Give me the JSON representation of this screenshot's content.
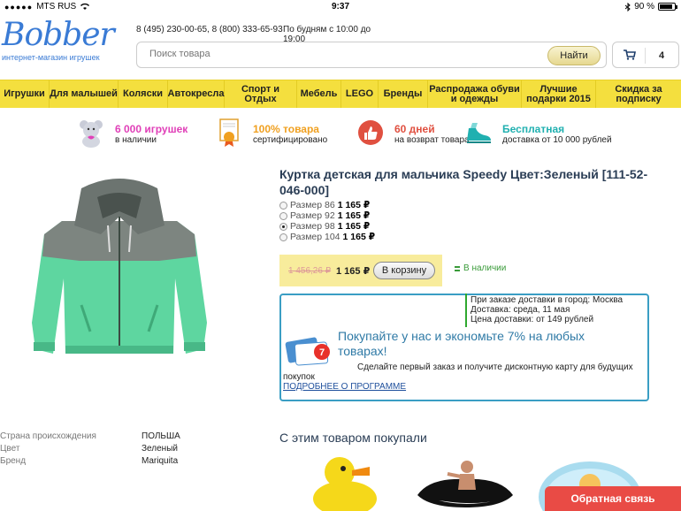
{
  "status_bar": {
    "carrier": "MTS RUS",
    "time": "9:37",
    "battery": "90 %",
    "battery_level": 0.9
  },
  "header": {
    "logo_text": "Bobber",
    "logo_tagline": "интернет-магазин игрушек",
    "phones": "8 (495) 230-00-65, 8 (800) 333-65-93",
    "hours": "По будням с 10:00 до 19:00",
    "search_placeholder": "Поиск товара",
    "search_button": "Найти",
    "cart_count": "4"
  },
  "nav": {
    "items": [
      "Игрушки",
      "Для малышей",
      "Коляски",
      "Автокресла",
      "Спорт и Отдых",
      "Мебель",
      "LEGO",
      "Бренды",
      "Распродажа обуви и одежды",
      "Лучшие подарки 2015",
      "Скидка за подписку"
    ]
  },
  "features": [
    {
      "title": "6 000 игрушек",
      "subtitle": "в наличии",
      "icon": "teddy-bear-icon",
      "color": "#e040b8"
    },
    {
      "title": "100% товара",
      "subtitle": "сертифицировано",
      "icon": "certificate-icon",
      "color": "#f0a020"
    },
    {
      "title": "60 дней",
      "subtitle": "на возврат товара",
      "icon": "thumbs-up-icon",
      "color": "#e05040"
    },
    {
      "title": "Бесплатная",
      "subtitle": "доставка от 10 000 рублей",
      "icon": "shoe-icon",
      "color": "#20b0b0"
    }
  ],
  "product": {
    "title": "Куртка детская для мальчика Speedy Цвет:Зеленый [111-52-046-000]",
    "sizes": [
      {
        "label": "Размер 86",
        "price": "1 165 ₽",
        "selected": false
      },
      {
        "label": "Размер 92",
        "price": "1 165 ₽",
        "selected": false
      },
      {
        "label": "Размер 98",
        "price": "1 165 ₽",
        "selected": true
      },
      {
        "label": "Размер 104",
        "price": "1 165 ₽",
        "selected": false
      }
    ],
    "old_price": "1 456,26 ₽",
    "price": "1 165 ₽",
    "cart_button": "В корзину",
    "stock": "В наличии"
  },
  "delivery": {
    "line1": "При заказе доставки в город: Москва",
    "line2": "Доставка: среда, 11 мая",
    "line3": "Цена доставки: от 149 рублей",
    "promo_heading": "Покупайте у нас и экономьте 7% на любых товарах!",
    "promo_text": "Сделайте первый заказ и получите дисконтную карту для будущих покупок",
    "promo_link": "ПОДРОБНЕЕ О ПРОГРАММЕ",
    "card_badge": "7"
  },
  "specs": [
    {
      "key": "Страна происхождения",
      "value": "ПОЛЬША"
    },
    {
      "key": "Цвет",
      "value": "Зеленый"
    },
    {
      "key": "Бренд",
      "value": "Mariquita"
    }
  ],
  "also_bought": {
    "heading": "С этим товаром покупали"
  },
  "feedback_button": "Обратная связь",
  "colors": {
    "nav_bg": "#f4df3e",
    "jacket_green": "#5ed6a0",
    "jacket_grey": "#7d8580",
    "title": "#2a3d55",
    "promo_border": "#3a9ec4",
    "feedback": "#e94b45"
  }
}
